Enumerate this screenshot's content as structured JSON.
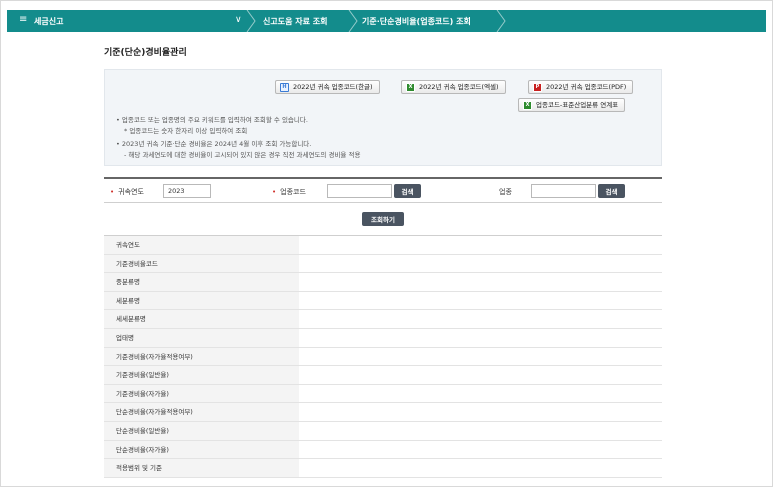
{
  "nav": {
    "menu_glyph": "≡",
    "home_label": "세금신고",
    "dropdown_glyph": "∨",
    "crumbs": [
      "신고도움 자료 조회",
      "기준·단순경비율(업종코드) 조회"
    ]
  },
  "page": {
    "title": "기준(단순)경비율관리"
  },
  "downloads": {
    "hwp": {
      "label": "2022년 귀속 업종코드(한글)",
      "icon_text": "H"
    },
    "excel": {
      "label": "2022년 귀속 업종코드(엑셀)",
      "icon_text": "X"
    },
    "pdf": {
      "label": "2022년 귀속 업종코드(PDF)",
      "icon_text": "P"
    },
    "link": {
      "label": "업종코드-표준산업분류 연계표",
      "icon_text": "X"
    }
  },
  "notes": {
    "line1": "• 업종코드 또는 업종명의 주요 키워드를 입력하여 조회할 수 있습니다.",
    "line2": "* 업종코드는 숫자 한자리 이상 입력하여 조회",
    "line3": "• 2023년 귀속 기준·단순 경비율은 2024년 4월 이후 조회 가능합니다.",
    "line4": "- 해당 과세연도에 대한 경비율이 고시되어 있지 않은 경우 직전 과세연도의 경비율 적용"
  },
  "search": {
    "required_mark": "•",
    "year_label": "귀속연도",
    "year_value": "2023",
    "code_label": "업종코드",
    "code_value": "",
    "code_button": "검색",
    "industry_label": "업종",
    "industry_value": "",
    "industry_button": "검색",
    "query_button": "조회하기"
  },
  "result_rows": [
    "귀속연도",
    "기준경비율코드",
    "중분류명",
    "세분류명",
    "세세분류명",
    "업태명",
    "기준경비율(자가율적용여부)",
    "기준경비율(일반율)",
    "기준경비율(자가율)",
    "단순경비율(자가율적용여부)",
    "단순경비율(일반율)",
    "단순경비율(자가율)",
    "적용범위 및 기준"
  ],
  "colors": {
    "nav_bg": "#138c8c",
    "button_dark": "#4a5461",
    "required_red": "#d0302b"
  }
}
